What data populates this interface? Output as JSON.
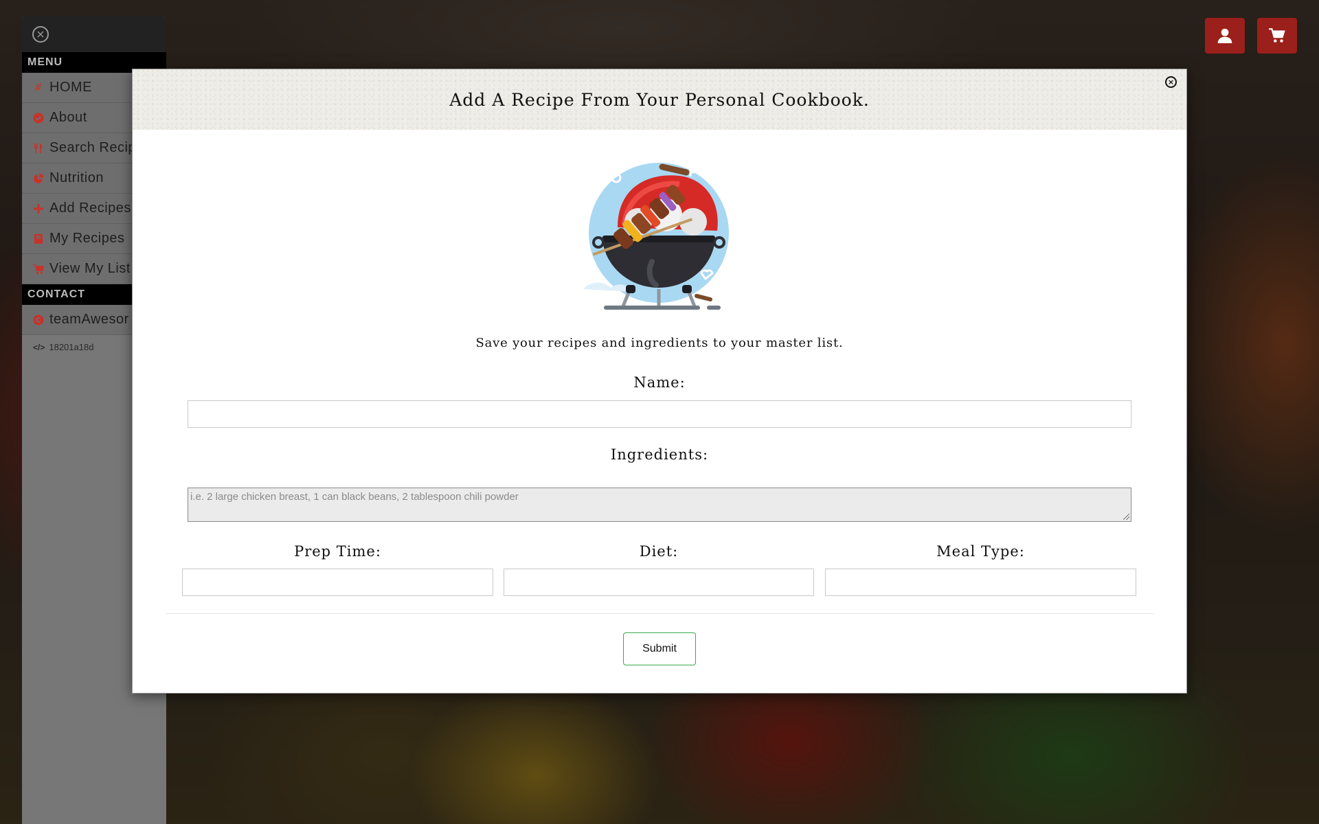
{
  "sidebar": {
    "menu_header": "MENU",
    "items": [
      {
        "icon": "hash-icon",
        "label": "HOME"
      },
      {
        "icon": "check-circle-icon",
        "label": "About"
      },
      {
        "icon": "utensils-icon",
        "label": "Search Recip"
      },
      {
        "icon": "pie-chart-icon",
        "label": "Nutrition"
      },
      {
        "icon": "plus-icon",
        "label": "Add Recipes"
      },
      {
        "icon": "book-icon",
        "label": "My Recipes"
      },
      {
        "icon": "cart-icon",
        "label": "View My List"
      }
    ],
    "contact_header": "CONTACT",
    "contact": {
      "icon": "copyright-icon",
      "label": "teamAwesor"
    },
    "version": {
      "icon": "code-icon",
      "label": "18201a18d"
    }
  },
  "topbar": {
    "user_icon": "user-icon",
    "cart_icon": "cart-icon"
  },
  "modal": {
    "title": "Add A Recipe From Your Personal Cookbook.",
    "illustration": "bbq-grill-illustration",
    "tagline": "Save your recipes and ingredients to your master list.",
    "name_label": "Name:",
    "name_value": "",
    "ingredients_label": "Ingredients:",
    "ingredients_placeholder": "i.e. 2 large chicken breast, 1 can black beans, 2 tablespoon chili powder",
    "prep_label": "Prep Time:",
    "diet_label": "Diet:",
    "meal_label": "Meal Type:",
    "submit_label": "Submit"
  },
  "colors": {
    "accent": "#c8322a",
    "top_button": "#9b1f1a",
    "submit_border": "#3aa84a"
  }
}
